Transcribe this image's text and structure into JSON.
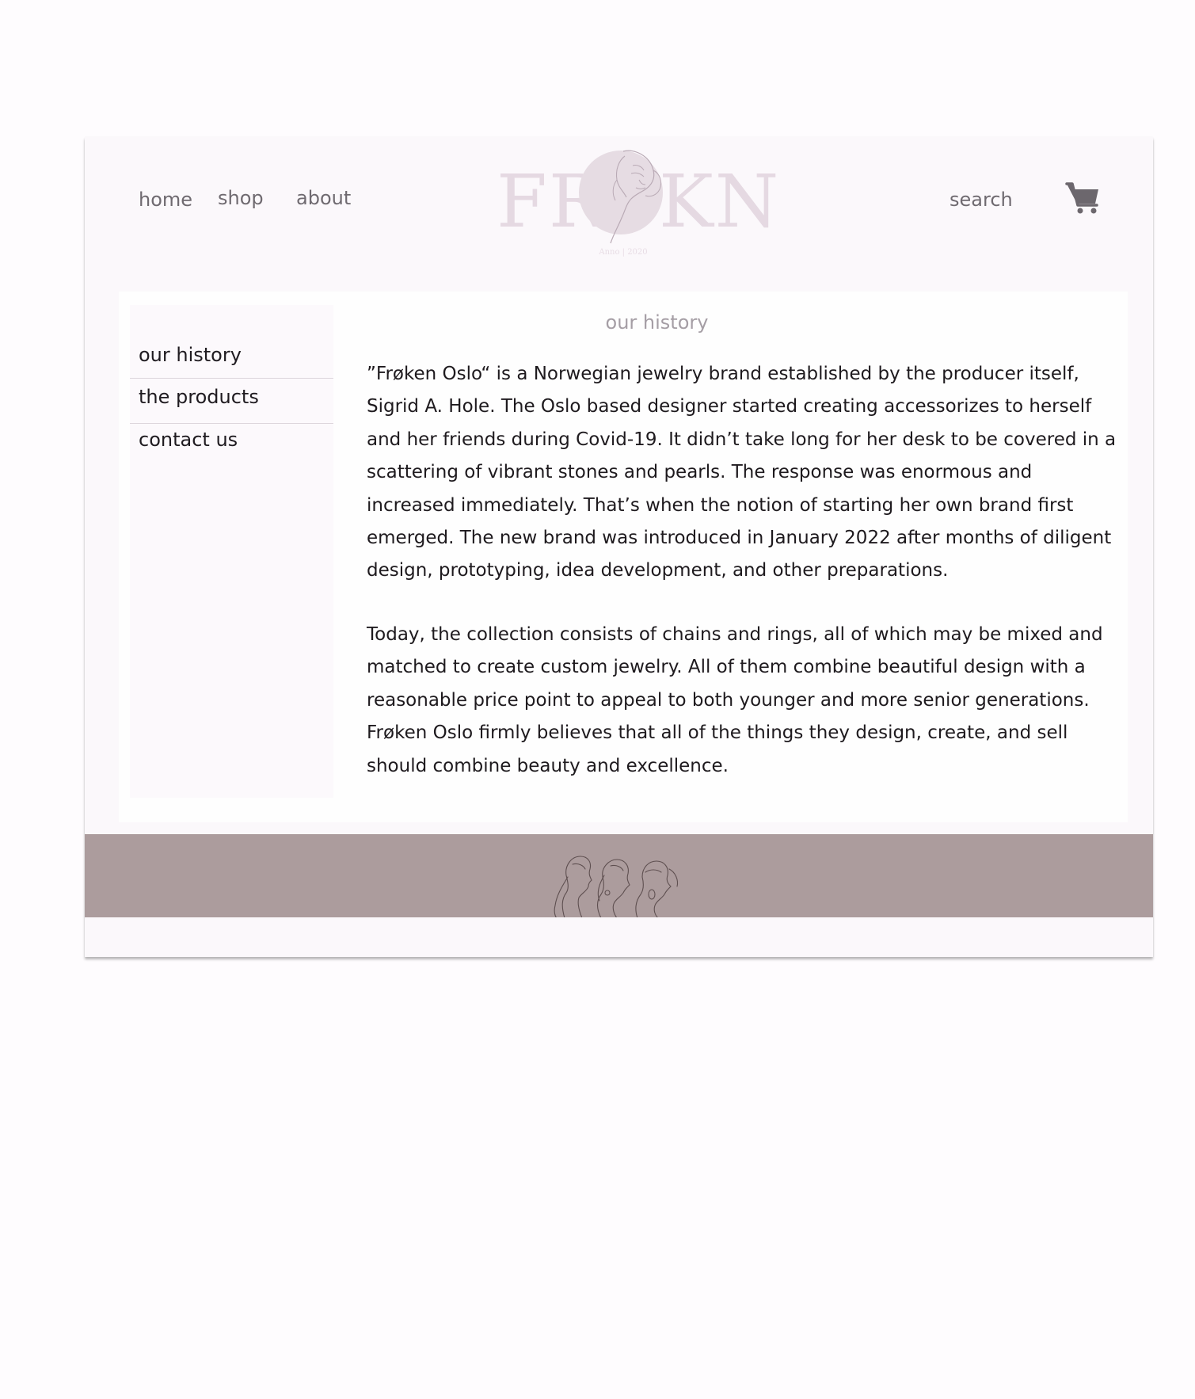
{
  "header": {
    "nav": [
      {
        "label": "home"
      },
      {
        "label": "shop"
      },
      {
        "label": "about"
      }
    ],
    "logo": {
      "letters_left": "FR",
      "letters_right": "KN",
      "subtitle": "Anno | 2020",
      "color": "#e5d9e2",
      "emblem_color": "#e6dce3"
    },
    "search_label": "search",
    "cart_icon": "shopping-cart-icon"
  },
  "sidebar": {
    "items": [
      {
        "label": "our history"
      },
      {
        "label": "the products"
      },
      {
        "label": "contact us"
      }
    ]
  },
  "main": {
    "title": "our history",
    "paragraphs": [
      "”Frøken Oslo“ is a Norwegian jewelry brand established by the producer itself, Sigrid A. Hole. The Oslo based designer started creating accessorizes to herself and her friends during Covid-19. It didn’t take long for her desk to be covered in a scattering of vibrant stones and pearls. The response was enormous and increased immediately. That’s when the notion of starting her own brand first emerged. The new brand was introduced in January 2022 after months of diligent design, prototyping, idea development, and other preparations.",
      "Today, the collection consists of chains and rings, all of which may be mixed and matched to create custom jewelry. All of them combine beautiful design with a reasonable price point to appeal to both younger and more senior generations. Frøken Oslo firmly believes that all of the things they design, create, and sell should combine beauty and excellence."
    ]
  },
  "footer": {
    "band_color": "#ac9c9d",
    "art_icon": "three-women-line-art"
  },
  "colors": {
    "page_background": "#fefcfe",
    "frame_background": "#fbf8fb",
    "nav_text": "#6f6a70",
    "body_text": "#1e1a1e",
    "muted_title": "#a59ea5"
  }
}
